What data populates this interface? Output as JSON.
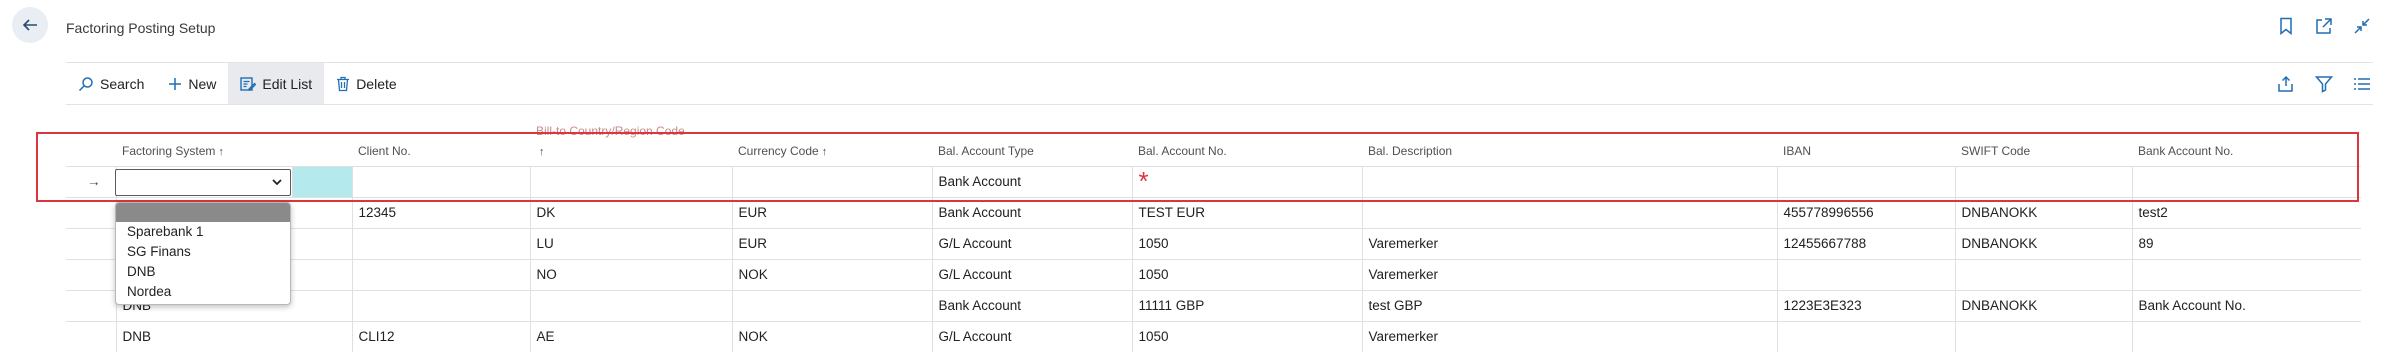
{
  "page": {
    "title": "Factoring Posting Setup"
  },
  "toolbar": {
    "search_label": "Search",
    "new_label": "New",
    "edit_list_label": "Edit List",
    "delete_label": "Delete"
  },
  "columns": {
    "factoring_system": "Factoring System",
    "client_no": "Client No.",
    "bill_to": "Bill-to Country/Region Code",
    "currency_code": "Currency Code",
    "bal_account_type": "Bal. Account Type",
    "bal_account_no": "Bal. Account No.",
    "bal_description": "Bal. Description",
    "iban": "IBAN",
    "swift_code": "SWIFT Code",
    "bank_account_no": "Bank Account No."
  },
  "new_row": {
    "bal_account_type": "Bank Account",
    "required_mark": "*"
  },
  "rows": [
    {
      "factoring_system": "",
      "client_no": "12345",
      "country": "DK",
      "currency": "EUR",
      "type": "Bank Account",
      "account_no": "TEST EUR",
      "description": "",
      "iban": "455778996556",
      "swift": "DNBANOKK",
      "bank_account_no": "test2"
    },
    {
      "factoring_system": "",
      "client_no": "",
      "country": "LU",
      "currency": "EUR",
      "type": "G/L Account",
      "account_no": "1050",
      "description": "Varemerker",
      "iban": "12455667788",
      "swift": "DNBANOKK",
      "bank_account_no": "89"
    },
    {
      "factoring_system": "",
      "client_no": "",
      "country": "NO",
      "currency": "NOK",
      "type": "G/L Account",
      "account_no": "1050",
      "description": "Varemerker",
      "iban": "",
      "swift": "",
      "bank_account_no": ""
    },
    {
      "factoring_system": "DNB",
      "client_no": "",
      "country": "",
      "currency": "",
      "type": "Bank Account",
      "account_no": "11111 GBP",
      "description": "test GBP",
      "iban": "1223E3E323",
      "swift": "DNBANOKK",
      "bank_account_no": "Bank Account No."
    },
    {
      "factoring_system": "DNB",
      "client_no": "CLI12",
      "country": "AE",
      "currency": "NOK",
      "type": "G/L Account",
      "account_no": "1050",
      "description": "Varemerker",
      "iban": "",
      "swift": "",
      "bank_account_no": ""
    }
  ],
  "dropdown": {
    "options": [
      "",
      "Sparebank 1",
      "SG Finans",
      "DNB",
      "Nordea"
    ]
  }
}
